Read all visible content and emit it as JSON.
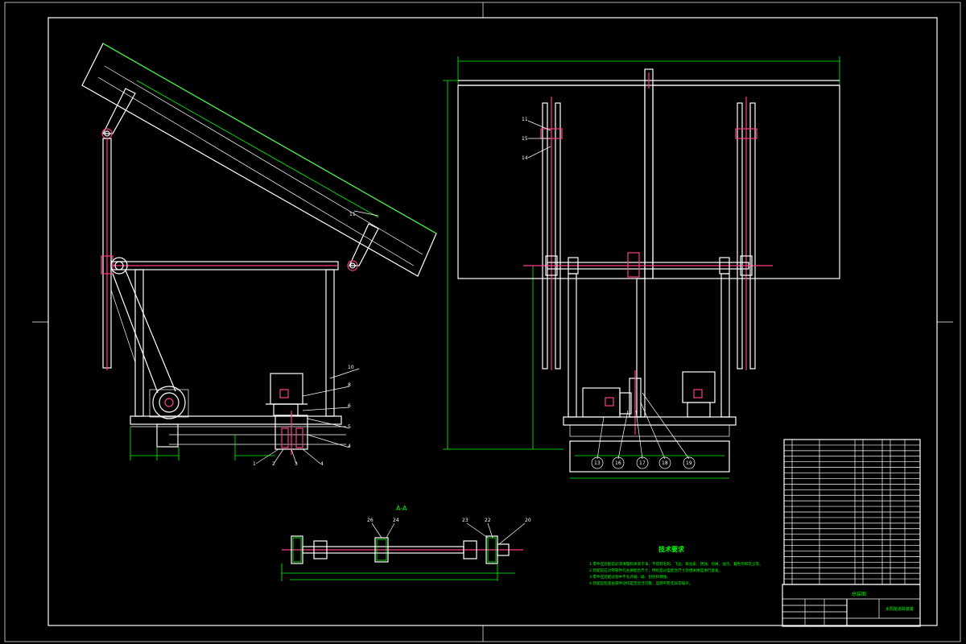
{
  "colors": {
    "background": "#000000",
    "outline": "#ffffff",
    "dimension": "#00ff00",
    "centerline": "#ff3b8a"
  },
  "views": {
    "side_view": {
      "panel_part_no": "11",
      "frame_part_no": "10",
      "callouts_right": [
        "8",
        "6",
        "5",
        "4"
      ],
      "callouts_bottom": [
        "1",
        "2",
        "3",
        "4"
      ]
    },
    "front_view": {
      "top_callouts": [
        "11",
        "15",
        "14"
      ],
      "bottom_callouts": [
        "13",
        "16",
        "17",
        "18",
        "19"
      ]
    },
    "section_view": {
      "title": "A-A",
      "callouts": [
        "26",
        "24",
        "23",
        "22",
        "20"
      ]
    }
  },
  "technical_requirements": {
    "title": "技术要求",
    "items": [
      "1.零件在装配前必须清理和清洗干净，不得有毛刺、飞边、氧化皮、锈蚀、切屑、油污、着色剂和灰尘等。",
      "2.装配前应对零部件的主要配合尺寸，特别是过盈配合尺寸及相关精度进行复查。",
      "3.零件在装配过程中不允许磕、碰、划伤和锈蚀。",
      "4.装配后检查各部件动作是否灵活可靠，运转平稳无异常噪声。"
    ]
  },
  "title_block": {
    "drawing_name": "太阳能追踪装置",
    "label": "总装图"
  }
}
